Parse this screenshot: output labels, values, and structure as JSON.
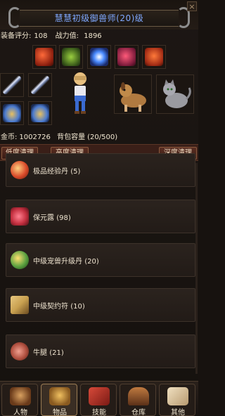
{
  "header": {
    "title": "慧慧初级御兽师(20)级",
    "close": "×"
  },
  "stats": {
    "rating_label": "装备评分:",
    "rating_value": "108",
    "power_label": "战力值:",
    "power_value": "1896"
  },
  "equipment_icons": [
    "helmet-icon",
    "gloves-icon",
    "amulet-icon",
    "boots-icon",
    "armor-icon",
    "sword-icon",
    "sword-icon",
    "wings-icon",
    "wings-icon"
  ],
  "pets": [
    "dog-pet",
    "cat-pet"
  ],
  "inventory": {
    "gold_label": "金币:",
    "gold_value": "1002726",
    "bag_label": "背包容量",
    "bag_value": "(20/500)"
  },
  "toolbar": {
    "low_clean": "低度清理",
    "high_clean": "高度清理",
    "deep_clean": "深度清理"
  },
  "items": [
    {
      "name": "极品经验丹",
      "count": "(5)",
      "color": "#d94a2a"
    },
    {
      "name": "保元露",
      "count": "(98)",
      "color": "#c43040"
    },
    {
      "name": "中级宠兽升级丹",
      "count": "(20)",
      "color": "#5aa040"
    },
    {
      "name": "中级契约符",
      "count": "(10)",
      "color": "#c8a050"
    },
    {
      "name": "牛腿",
      "count": "(21)",
      "color": "#b05040"
    }
  ],
  "nav": [
    {
      "label": "人物",
      "active": false
    },
    {
      "label": "物品",
      "active": true
    },
    {
      "label": "技能",
      "active": false
    },
    {
      "label": "仓库",
      "active": false
    },
    {
      "label": "其他",
      "active": false
    }
  ]
}
